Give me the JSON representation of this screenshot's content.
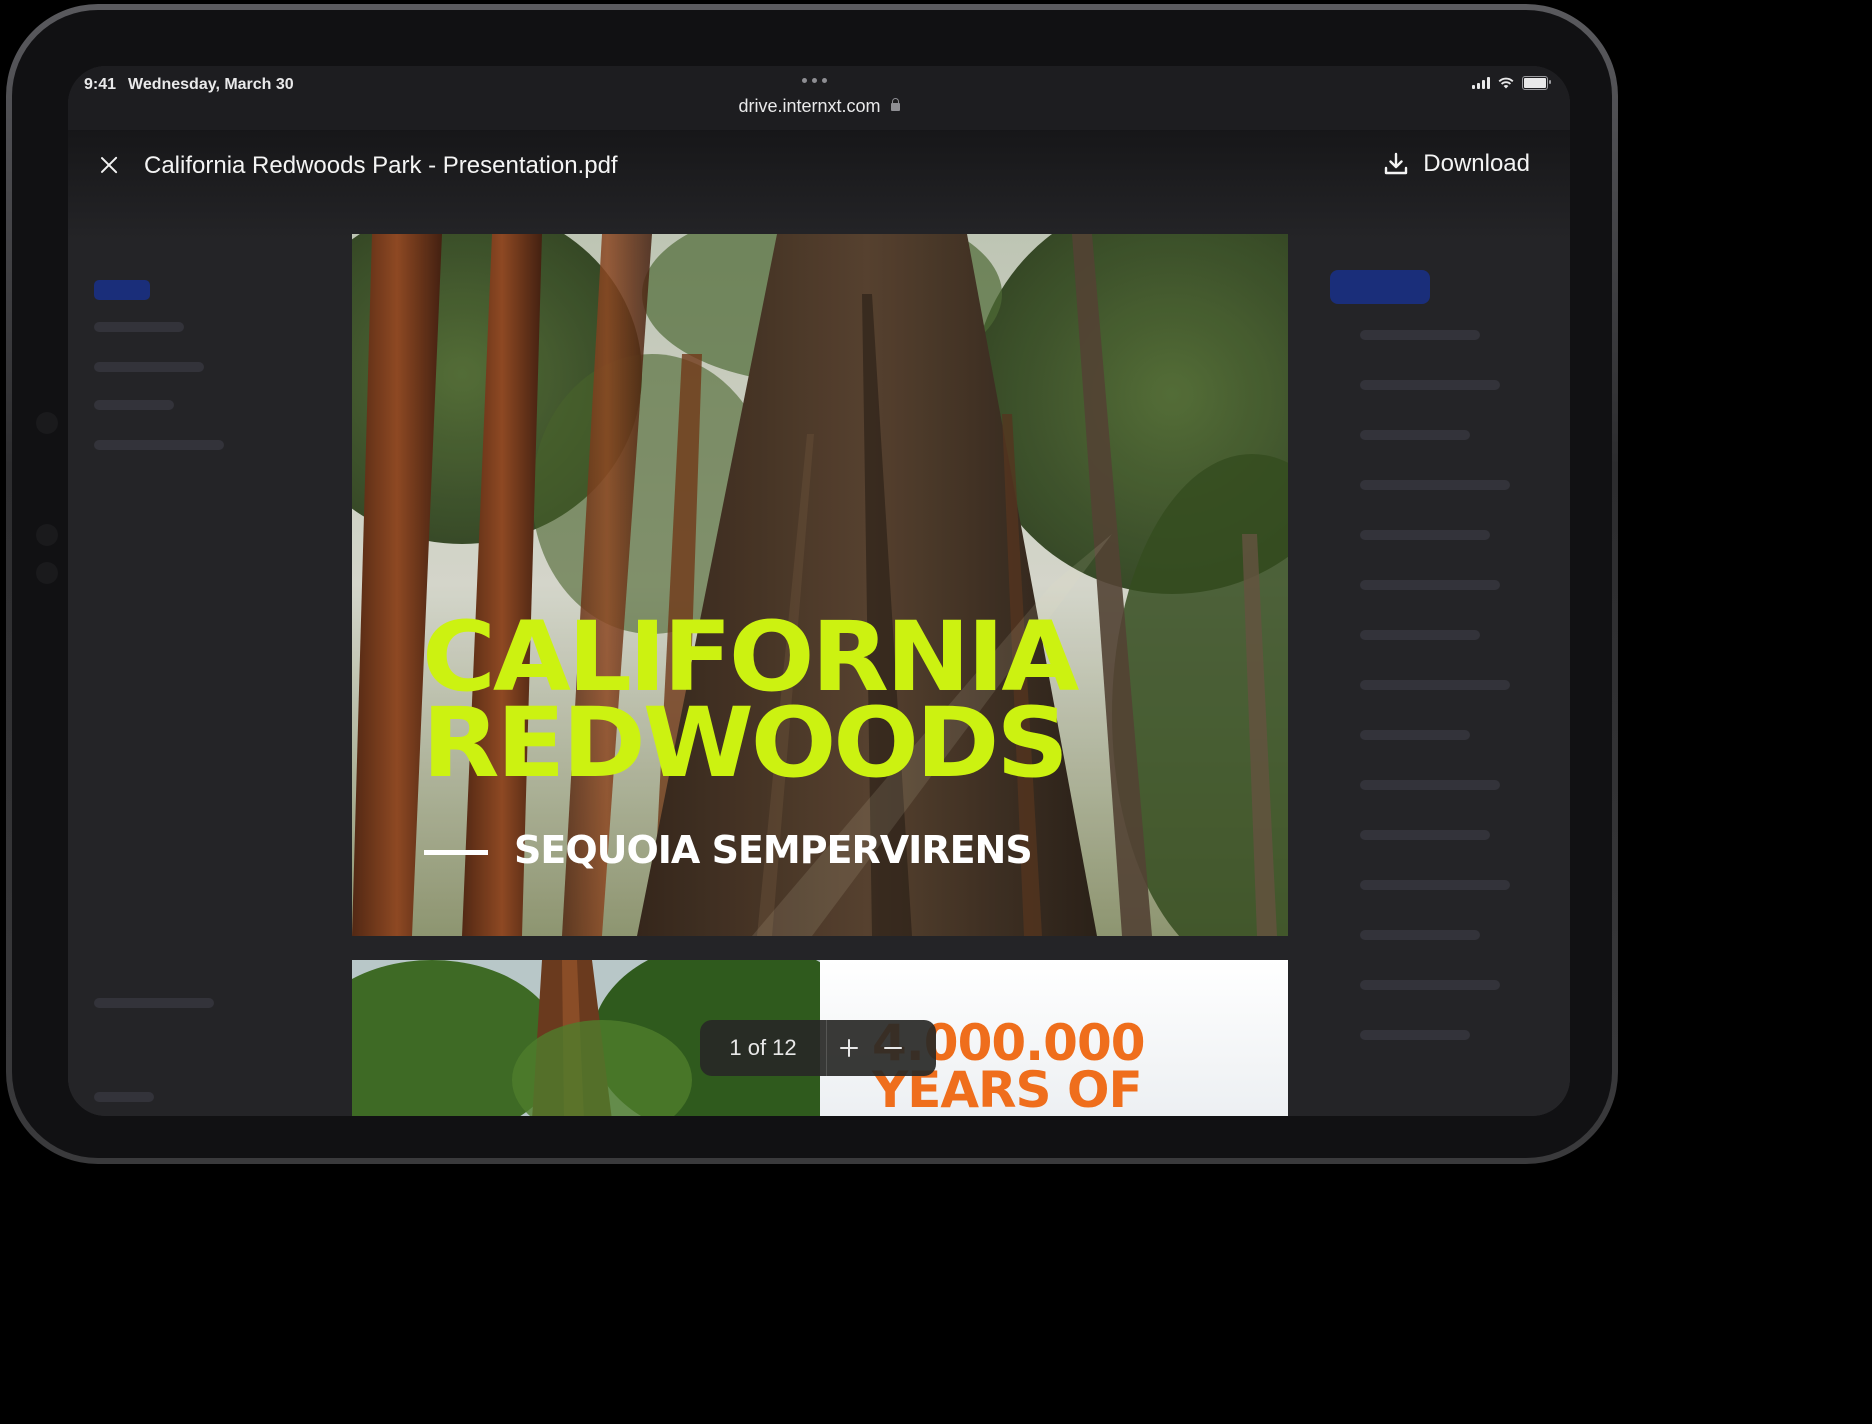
{
  "status_bar": {
    "time": "9:41",
    "date": "Wednesday, March 30"
  },
  "browser": {
    "url": "drive.internxt.com"
  },
  "viewer": {
    "file_name": "California Redwoods Park - Presentation.pdf",
    "download_label": "Download",
    "page_indicator": "1 of 12"
  },
  "slides": {
    "slide1": {
      "headline_line1": "CALIFORNIA",
      "headline_line2": "REDWOODS",
      "subheadline": "SEQUOIA SEMPERVIRENS"
    },
    "slide2": {
      "stat_line1": "4.000.000",
      "stat_line2": "YEARS OF"
    }
  },
  "colors": {
    "headline": "#ccf211",
    "stat": "#ef6e1c"
  }
}
